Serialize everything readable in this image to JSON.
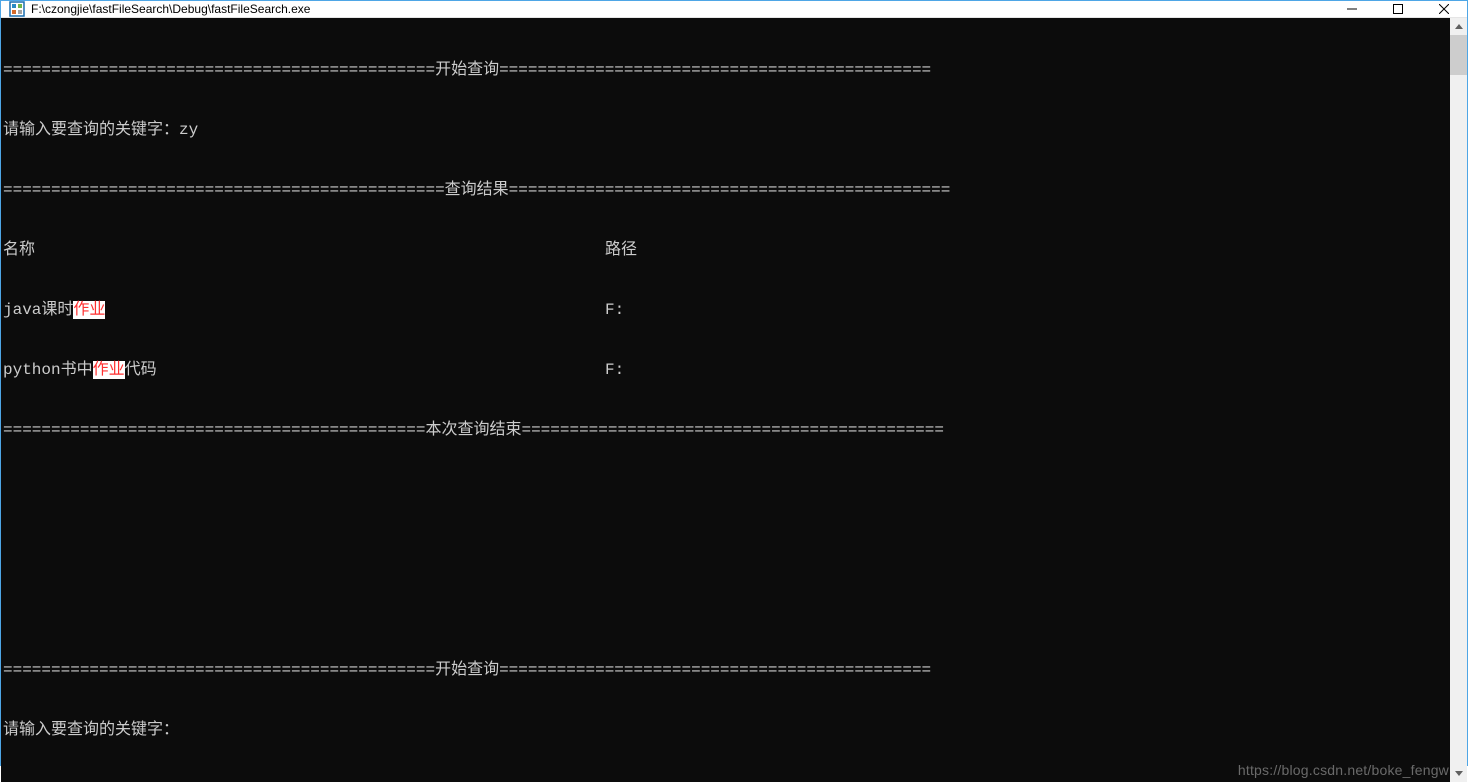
{
  "window": {
    "title": "F:\\czongjie\\fastFileSearch\\Debug\\fastFileSearch.exe"
  },
  "console": {
    "divider_start_query": "=============================================开始查询=============================================",
    "prompt_label": "请输入要查询的关键字：",
    "query1_input": "zy",
    "divider_results": "==============================================查询结果==============================================",
    "header_name": "名称",
    "header_path": "路径",
    "results": [
      {
        "name_prefix": "java课时",
        "name_hl": "作业",
        "name_suffix": "",
        "path": "F:"
      },
      {
        "name_prefix": "python书中",
        "name_hl": "作业",
        "name_suffix": "代码",
        "path": "F:"
      }
    ],
    "divider_end": "============================================本次查询结束============================================",
    "divider_start_query2": "=============================================开始查询=============================================",
    "prompt_label2": "请输入要查询的关键字："
  },
  "watermark": "https://blog.csdn.net/boke_fengw"
}
